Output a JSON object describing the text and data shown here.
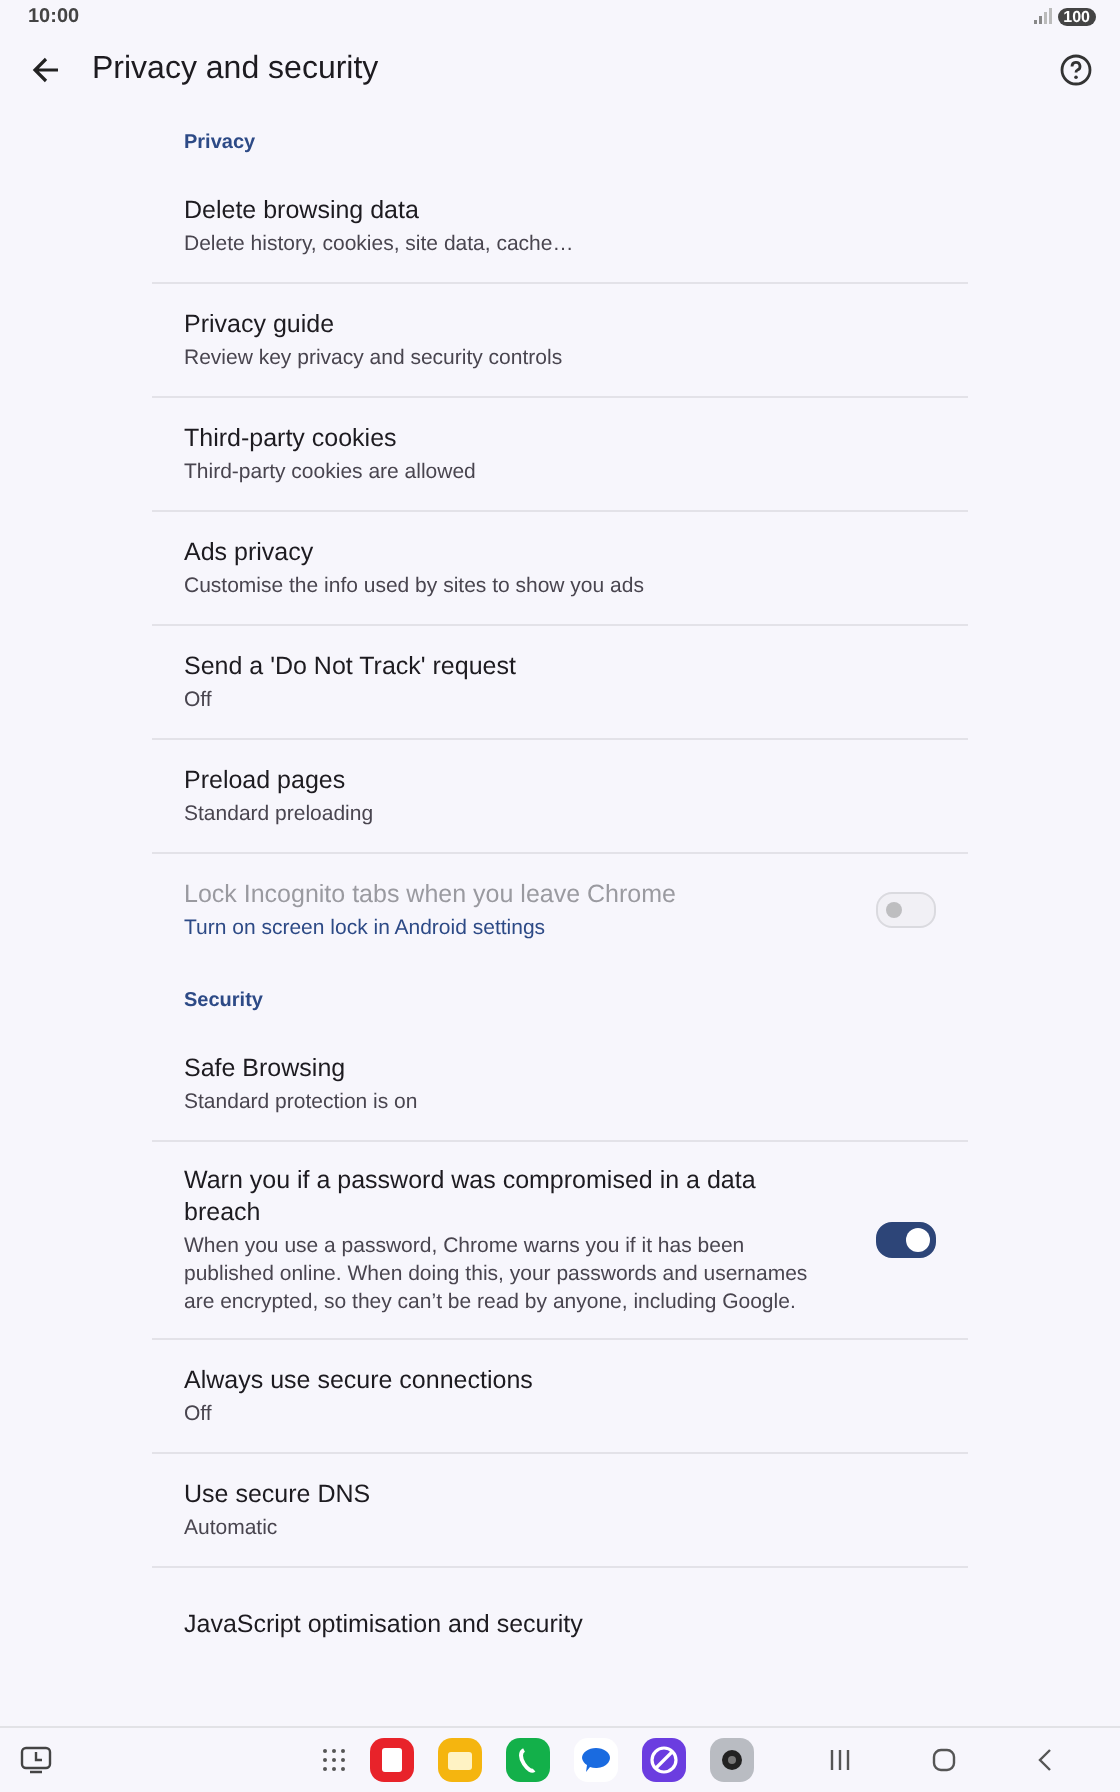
{
  "status_bar": {
    "time": "10:00",
    "battery": "100"
  },
  "header": {
    "title": "Privacy and security"
  },
  "sections": [
    {
      "title": "Privacy",
      "rows": [
        {
          "kind": "nav",
          "title": "Delete browsing data",
          "subtitle": "Delete history, cookies, site data, cache…"
        },
        {
          "kind": "nav",
          "title": "Privacy guide",
          "subtitle": "Review key privacy and security controls"
        },
        {
          "kind": "nav",
          "title": "Third-party cookies",
          "subtitle": "Third-party cookies are allowed"
        },
        {
          "kind": "nav",
          "title": "Ads privacy",
          "subtitle": "Customise the info used by sites to show you ads"
        },
        {
          "kind": "nav",
          "title": "Send a 'Do Not Track' request",
          "subtitle": "Off"
        },
        {
          "kind": "nav",
          "title": "Preload pages",
          "subtitle": "Standard preloading"
        },
        {
          "kind": "toggle",
          "title": "Lock Incognito tabs when you leave Chrome",
          "subtitle": "Turn on screen lock in Android settings",
          "subtitle_link": true,
          "on": false,
          "disabled": true
        }
      ]
    },
    {
      "title": "Security",
      "rows": [
        {
          "kind": "nav",
          "title": "Safe Browsing",
          "subtitle": "Standard protection is on"
        },
        {
          "kind": "toggle",
          "title": "Warn you if a password was compromised in a data breach",
          "subtitle": "When you use a password, Chrome warns you if it has been published online. When doing this, your passwords and usernames are encrypted, so they can’t be read by anyone, including Google.",
          "on": true,
          "disabled": false
        },
        {
          "kind": "nav",
          "title": "Always use secure connections",
          "subtitle": "Off"
        },
        {
          "kind": "nav",
          "title": "Use secure DNS",
          "subtitle": "Automatic"
        },
        {
          "kind": "nav",
          "title": "JavaScript optimisation and security"
        }
      ]
    }
  ]
}
